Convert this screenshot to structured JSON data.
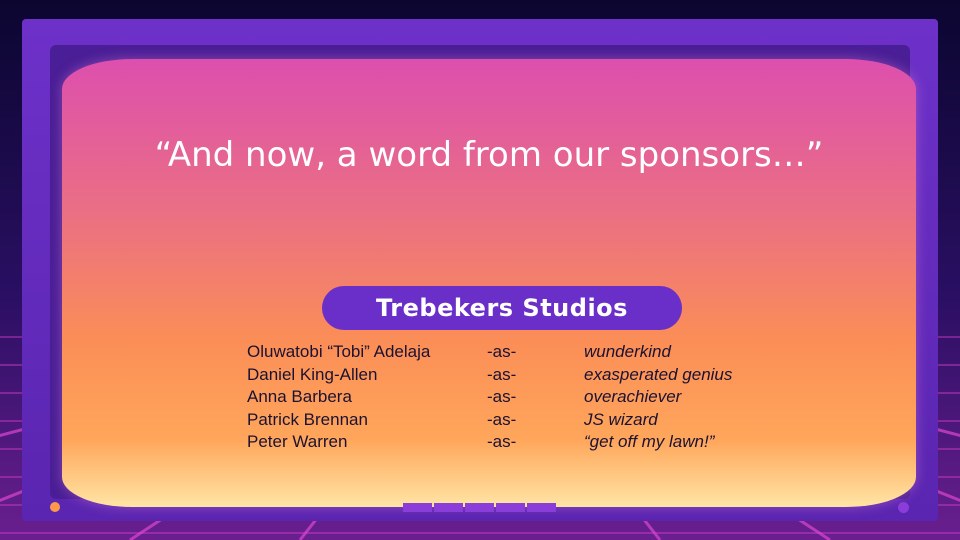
{
  "slide": {
    "headline": "“And now, a word from our sponsors…”",
    "studio_name": "Trebekers Studios",
    "credits": [
      {
        "name": "Oluwatobi “Tobi” Adelaja",
        "as": "-as-",
        "role": "wunderkind"
      },
      {
        "name": "Daniel King-Allen",
        "as": "-as-",
        "role": "exasperated genius"
      },
      {
        "name": "Anna Barbera",
        "as": "-as-",
        "role": "overachiever"
      },
      {
        "name": "Patrick Brennan",
        "as": "-as-",
        "role": "JS wizard"
      },
      {
        "name": "Peter Warren",
        "as": "-as-",
        "role": "“get off my lawn!”"
      }
    ]
  },
  "colors": {
    "frame": "#6d31c9",
    "pill": "#6a2fc8",
    "screen_top": "#dd4fae",
    "screen_bottom": "#ffe5a5",
    "power_light": "#ff9a4a"
  }
}
